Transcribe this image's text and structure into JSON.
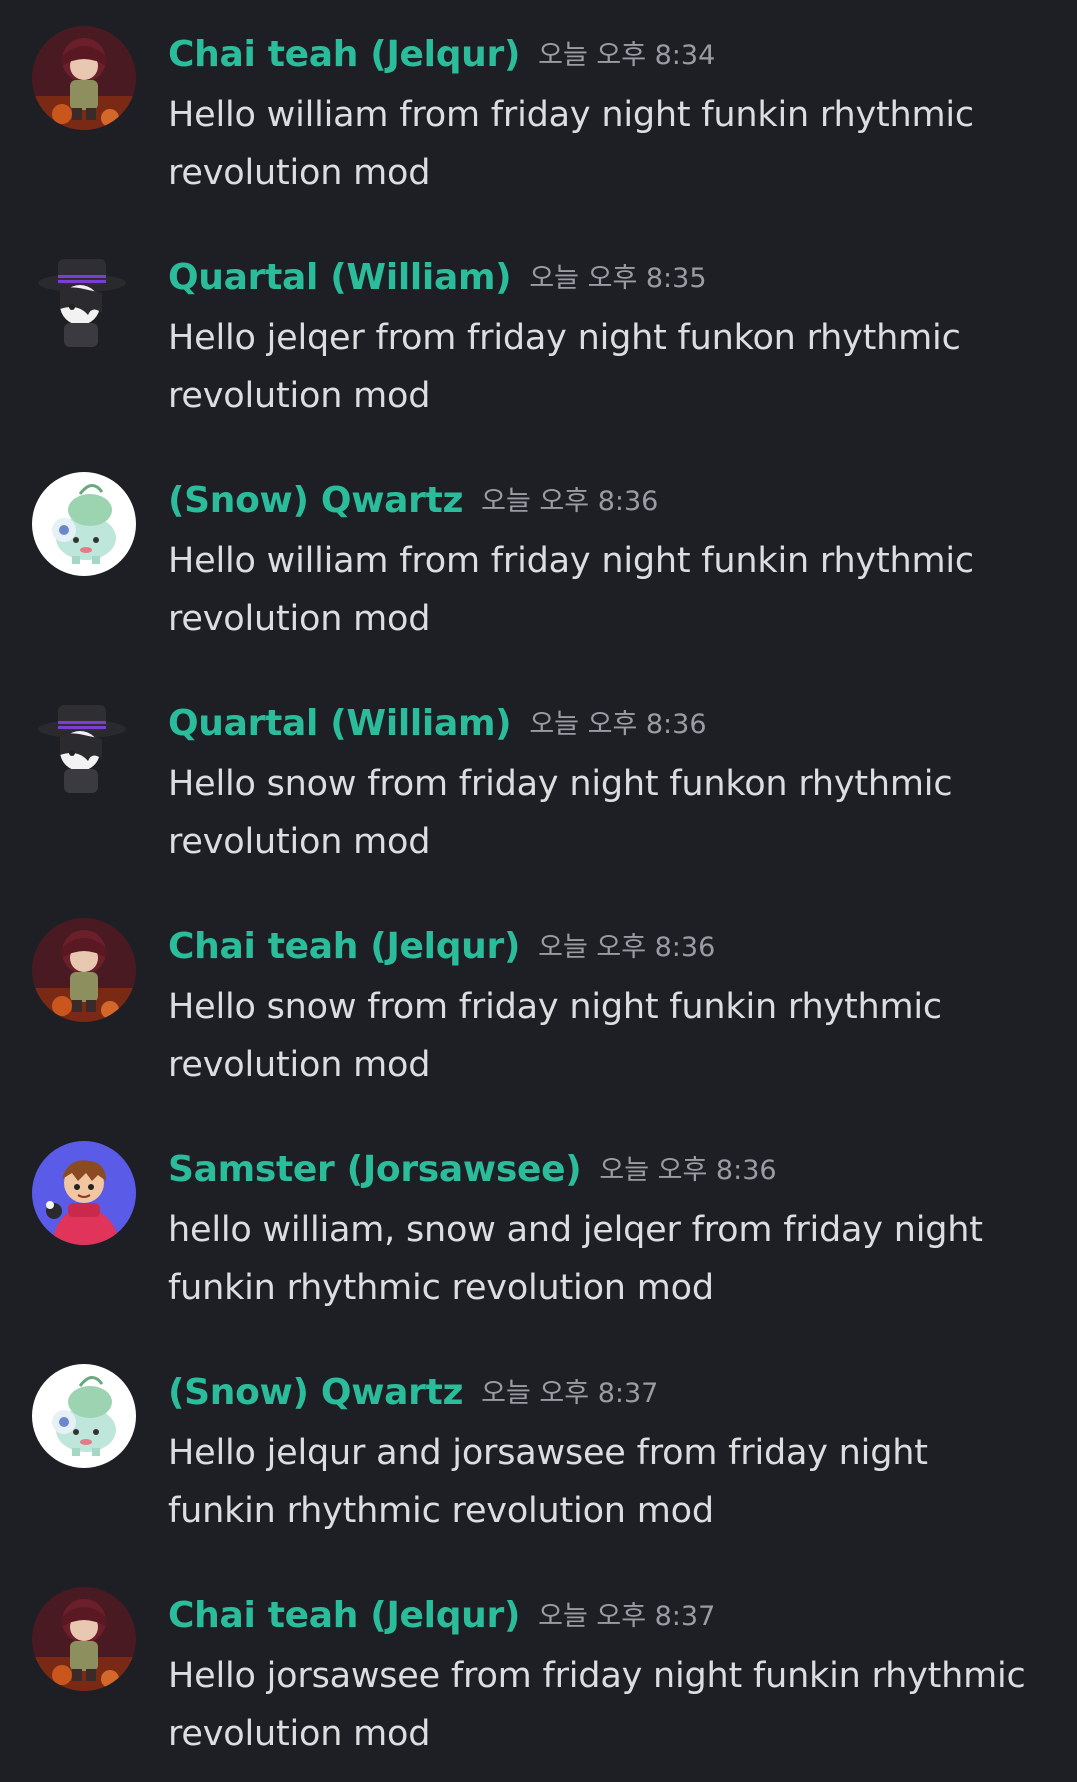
{
  "messages": [
    {
      "author": "Chai teah (Jelqur)",
      "time": "오늘 오후 8:34",
      "text": "Hello william from friday night funkin rhythmic revolution mod",
      "avatar": "jelqur-avatar"
    },
    {
      "author": "Quartal (William)",
      "time": "오늘 오후 8:35",
      "text": "Hello jelqer from friday night funkon rhythmic revolution mod",
      "avatar": "william-avatar"
    },
    {
      "author": "(Snow) Qwartz",
      "time": "오늘 오후 8:36",
      "text": "Hello william from friday night funkin rhythmic revolution mod",
      "avatar": "snow-avatar"
    },
    {
      "author": "Quartal (William)",
      "time": "오늘 오후 8:36",
      "text": "Hello snow from friday night funkon rhythmic revolution mod",
      "avatar": "william-avatar"
    },
    {
      "author": "Chai teah (Jelqur)",
      "time": "오늘 오후 8:36",
      "text": "Hello snow from friday night funkin rhythmic revolution mod",
      "avatar": "jelqur-avatar"
    },
    {
      "author": "Samster (Jorsawsee)",
      "time": "오늘 오후 8:36",
      "text": "hello william, snow and jelqer from friday night funkin rhythmic revolution mod",
      "avatar": "jorsawsee-avatar"
    },
    {
      "author": "(Snow) Qwartz",
      "time": "오늘 오후 8:37",
      "text": "Hello jelqur and jorsawsee from friday night funkin rhythmic revolution mod",
      "avatar": "snow-avatar"
    },
    {
      "author": "Chai teah (Jelqur)",
      "time": "오늘 오후 8:37",
      "text": "Hello jorsawsee from friday night funkin rhythmic revolution mod",
      "avatar": "jelqur-avatar"
    }
  ],
  "colors": {
    "background": "#1e1f24",
    "author": "#2bbd9b",
    "timestamp": "#9b9ca3",
    "text": "#dcdde1"
  }
}
